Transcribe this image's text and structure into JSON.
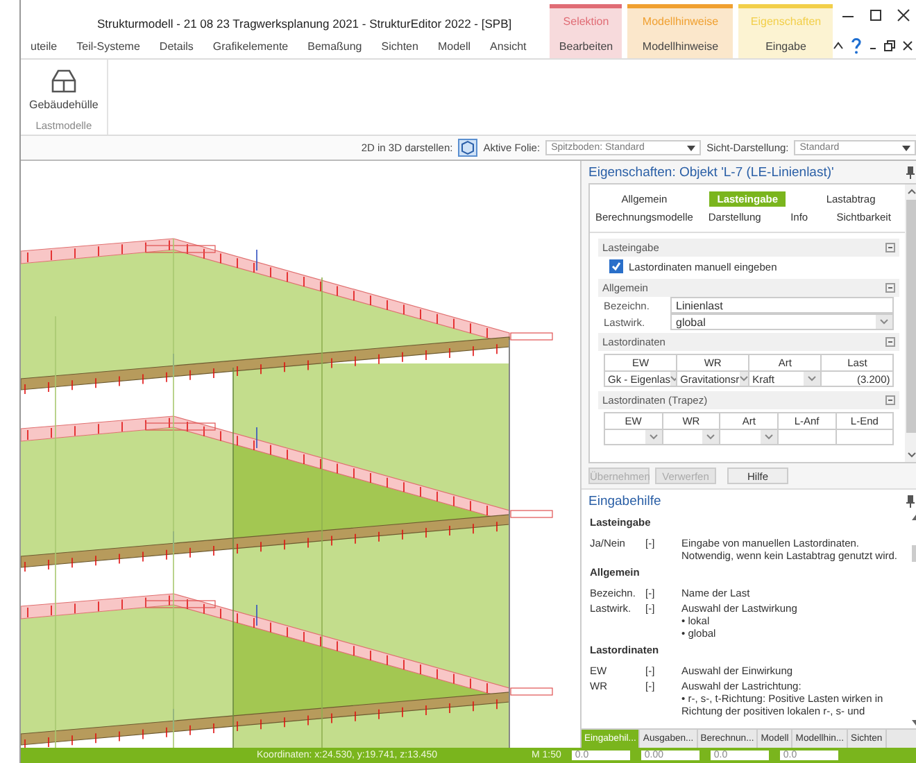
{
  "window": {
    "title": "Strukturmodell - 21 08 23 Tragwerksplanung 2021 - StrukturEditor 2022 - [SPB]"
  },
  "ribbon_tabs": [
    {
      "label": "uteile"
    },
    {
      "label": "Teil-Systeme"
    },
    {
      "label": "Details"
    },
    {
      "label": "Grafikelemente"
    },
    {
      "label": "Bemaßung"
    },
    {
      "label": "Sichten"
    },
    {
      "label": "Modell"
    },
    {
      "label": "Ansicht"
    },
    {
      "label": "Bearbeiten",
      "group": "Selektion",
      "color": "#e06c75"
    },
    {
      "label": "Modellhinweise",
      "group": "Modellhinweise",
      "color": "#f0a030"
    },
    {
      "label": "Eingabe",
      "group": "Eigenschaften",
      "color": "#f2cf4a"
    }
  ],
  "ribbon": {
    "buttons": [
      {
        "label": "Gebäudehülle"
      }
    ],
    "group_label": "Lastmodelle"
  },
  "toolbar": {
    "display_label": "2D in 3D darstellen:",
    "layer_label": "Aktive Folie:",
    "layer_value": "Spitzboden: Standard",
    "view_label": "Sicht-Darstellung:",
    "view_value": "Standard"
  },
  "properties": {
    "title": "Eigenschaften: Objekt 'L-7 (LE-Linienlast)'",
    "tabs": [
      {
        "label": "Allgemein",
        "selected": false
      },
      {
        "label": "Lasteingabe",
        "selected": true
      },
      {
        "label": "Lastabtrag",
        "selected": false
      },
      {
        "label": "Berechnungsmodelle",
        "selected": false
      },
      {
        "label": "Darstellung",
        "selected": false
      },
      {
        "label": "Info",
        "selected": false
      },
      {
        "label": "Sichtbarkeit",
        "selected": false
      }
    ],
    "lasteingabe": {
      "heading": "Lasteingabe",
      "checkbox_label": "Lastordinaten manuell eingeben",
      "checked": true
    },
    "allgemein": {
      "heading": "Allgemein",
      "fields": [
        {
          "label": "Bezeichn.",
          "value": "Linienlast",
          "kind": "text"
        },
        {
          "label": "Lastwirk.",
          "value": "global",
          "kind": "select"
        }
      ]
    },
    "lastordinaten": {
      "heading": "Lastordinaten",
      "columns": [
        "EW",
        "WR",
        "Art",
        "Last"
      ],
      "row": [
        {
          "value": "Gk - Eigenlas",
          "kind": "select"
        },
        {
          "value": "Gravitationsr",
          "kind": "select"
        },
        {
          "value": "Kraft",
          "kind": "select"
        },
        {
          "value": "(3.200)",
          "kind": "number"
        }
      ]
    },
    "trapez": {
      "heading": "Lastordinaten (Trapez)",
      "columns": [
        "EW",
        "WR",
        "Art",
        "L-Anf",
        "L-End"
      ],
      "row": [
        {
          "kind": "select"
        },
        {
          "kind": "select"
        },
        {
          "kind": "select"
        },
        {
          "kind": "number"
        },
        {
          "kind": "number"
        }
      ]
    },
    "buttons": [
      {
        "label": "Übernehmen",
        "disabled": true
      },
      {
        "label": "Verwerfen",
        "disabled": true
      },
      {
        "label": "Hilfe",
        "disabled": false
      }
    ]
  },
  "help": {
    "title": "Eingabehilfe",
    "sections": [
      {
        "heading": "Lasteingabe",
        "rows": [
          {
            "term": "Ja/Nein",
            "unit": "[-]",
            "lines": [
              "Eingabe von manuellen Lastordinaten. Notwendig, wenn kein Lastabtrag genutzt wird."
            ]
          }
        ]
      },
      {
        "heading": "Allgemein",
        "rows": [
          {
            "term": "Bezeichn.",
            "unit": "[-]",
            "lines": [
              "Name der Last"
            ]
          },
          {
            "term": "Lastwirk.",
            "unit": "[-]",
            "lines": [
              "Auswahl der Lastwirkung",
              "• lokal",
              "• global"
            ]
          }
        ]
      },
      {
        "heading": "Lastordinaten",
        "rows": [
          {
            "term": "EW",
            "unit": "[-]",
            "lines": [
              "Auswahl der Einwirkung"
            ]
          },
          {
            "term": "WR",
            "unit": "[-]",
            "lines": [
              "Auswahl der Lastrichtung:",
              "• r-, s-, t-Richtung: Positive Lasten wirken in Richtung der positiven lokalen r-, s- und"
            ]
          }
        ]
      }
    ]
  },
  "bottom_tabs": [
    {
      "label": "Eingabehil...",
      "selected": true
    },
    {
      "label": "Ausgaben...",
      "selected": false
    },
    {
      "label": "Berechnun...",
      "selected": false
    },
    {
      "label": "Modell",
      "selected": false
    },
    {
      "label": "Modellhin...",
      "selected": false
    },
    {
      "label": "Sichten",
      "selected": false
    }
  ],
  "status_bar": {
    "coordinates": "Koordinaten: x:24.530, y:19.741, z:13.450",
    "scale": "M 1:50",
    "fields": [
      "0.0",
      "0.00",
      "0.0",
      "0.0"
    ]
  }
}
